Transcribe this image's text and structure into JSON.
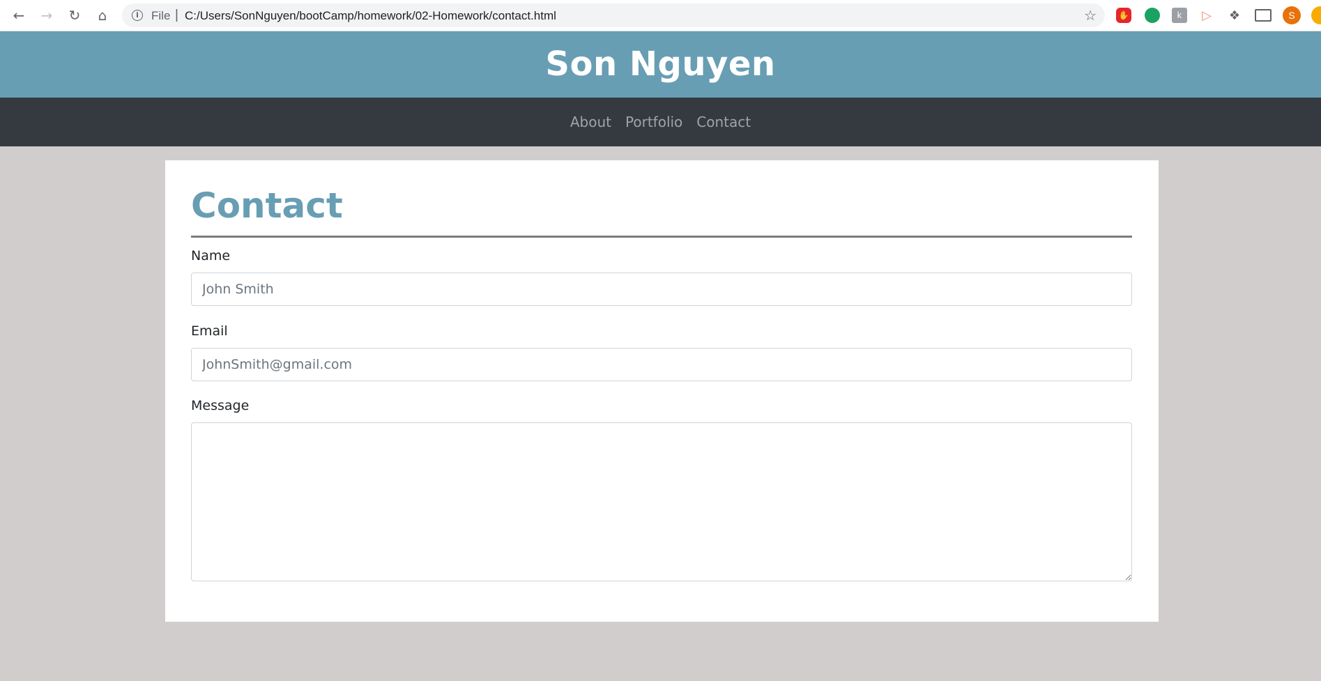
{
  "browser": {
    "file_label": "File",
    "url": "C:/Users/SonNguyen/bootCamp/homework/02-Homework/contact.html",
    "avatar_letter": "S",
    "icons": [
      "back-icon",
      "forward-icon",
      "reload-icon",
      "home-icon",
      "info-icon",
      "star-icon",
      "adblock-icon",
      "grammarly-icon",
      "extension-icon",
      "video-icon",
      "puzzle-icon",
      "cast-icon",
      "profile-avatar"
    ]
  },
  "site": {
    "title": "Son Nguyen",
    "nav": [
      "About",
      "Portfolio",
      "Contact"
    ]
  },
  "page": {
    "heading": "Contact",
    "fields": {
      "name_label": "Name",
      "name_placeholder": "John Smith",
      "email_label": "Email",
      "email_placeholder": "JohnSmith@gmail.com",
      "message_label": "Message"
    }
  },
  "colors": {
    "header_bg": "#689eb3",
    "nav_bg": "#343a40",
    "page_bg": "#d1cdcc",
    "heading": "#689eb3"
  }
}
